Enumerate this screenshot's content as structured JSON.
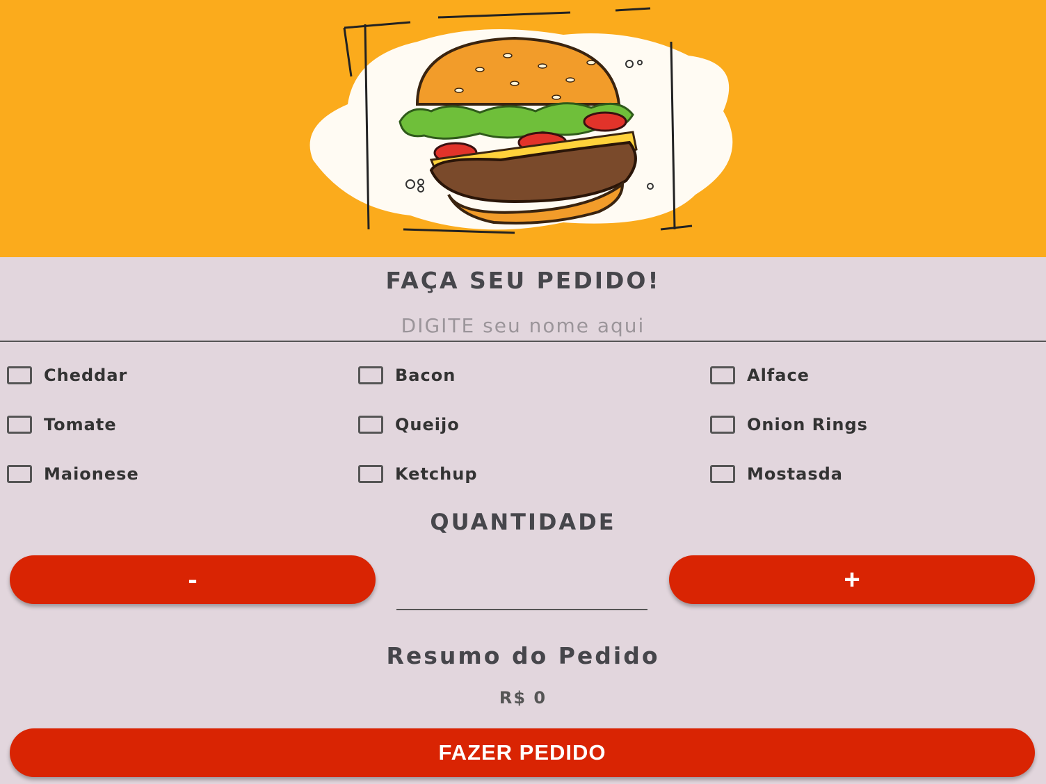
{
  "banner": {
    "image": "burger-illustration"
  },
  "header": {
    "title": "FAÇA SEU PEDIDO!"
  },
  "name_field": {
    "placeholder": "DIGITE seu nome aqui",
    "value": ""
  },
  "extras": [
    {
      "label": "Cheddar",
      "checked": false
    },
    {
      "label": "Bacon",
      "checked": false
    },
    {
      "label": "Alface",
      "checked": false
    },
    {
      "label": "Tomate",
      "checked": false
    },
    {
      "label": "Queijo",
      "checked": false
    },
    {
      "label": "Onion Rings",
      "checked": false
    },
    {
      "label": "Maionese",
      "checked": false
    },
    {
      "label": "Ketchup",
      "checked": false
    },
    {
      "label": "Mostasda",
      "checked": false
    }
  ],
  "quantity": {
    "title": "QUANTIDADE",
    "decrement_label": "-",
    "increment_label": "+",
    "value": ""
  },
  "summary": {
    "title": "Resumo do Pedido",
    "total": "R$ 0"
  },
  "order_button": {
    "label": "FAZER PEDIDO"
  },
  "colors": {
    "banner": "#fbab1c",
    "background": "#e2d6dd",
    "accent": "#d92403"
  }
}
